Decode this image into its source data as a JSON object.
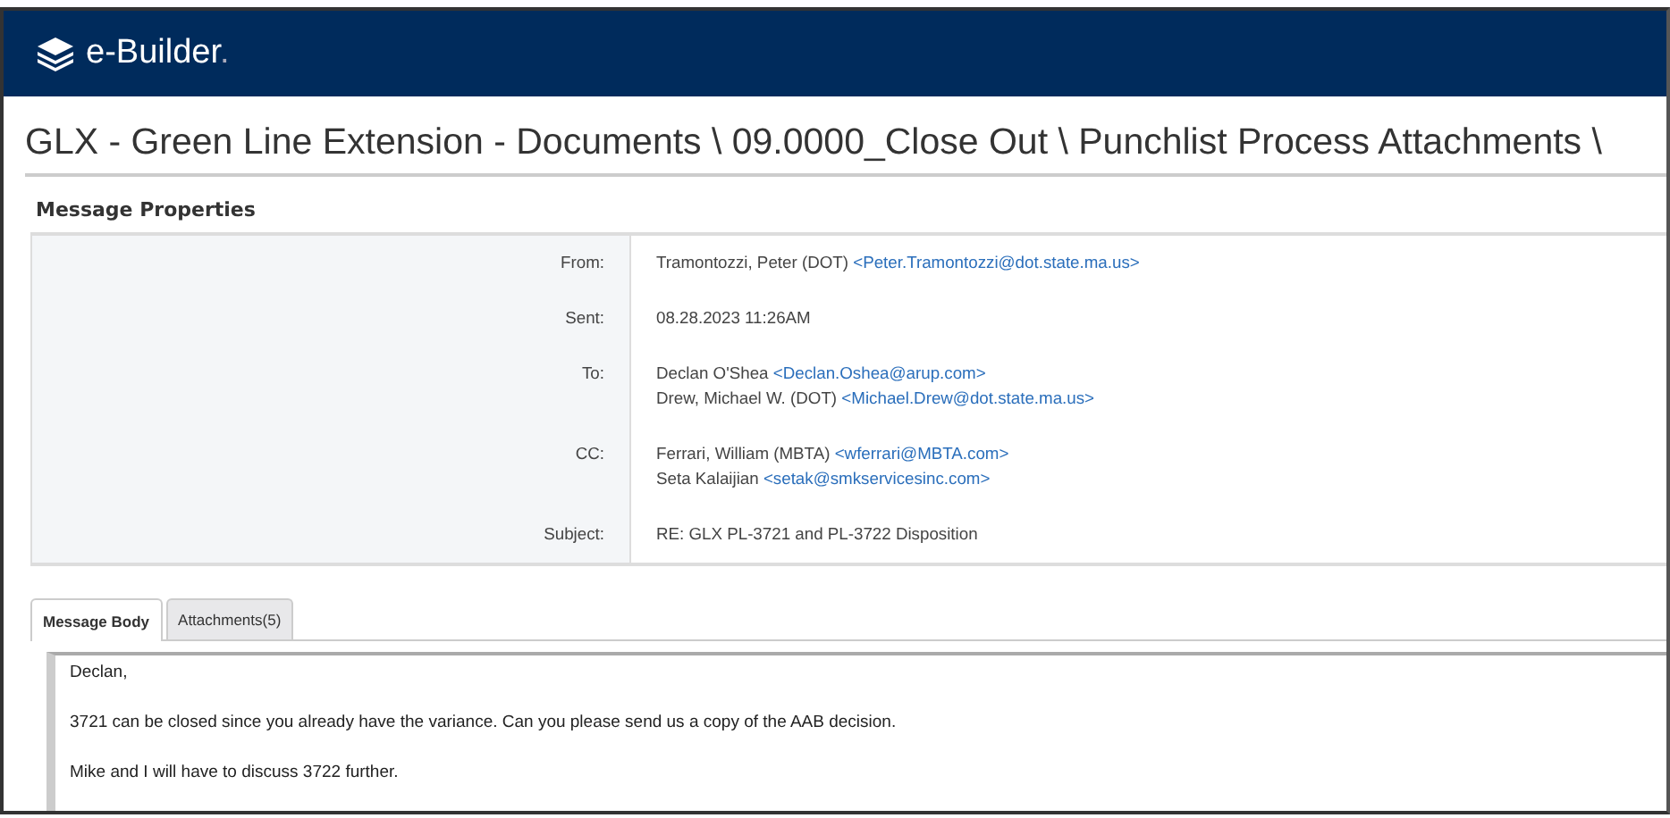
{
  "header": {
    "brand": "e-Builder",
    "brand_mark": "."
  },
  "title": "GLX - Green Line Extension - Documents \\ 09.0000_Close Out \\ Punchlist Process Attachments \\",
  "section_title": "Message Properties",
  "properties": [
    {
      "label": "From:",
      "kind": "people",
      "people": [
        {
          "name": "Tramontozzi, Peter (DOT)",
          "email": "<Peter.Tramontozzi@dot.state.ma.us>"
        }
      ]
    },
    {
      "label": "Sent:",
      "kind": "text",
      "value": "08.28.2023 11:26AM"
    },
    {
      "label": "To:",
      "kind": "people",
      "people": [
        {
          "name": "Declan O'Shea",
          "email": "<Declan.Oshea@arup.com>"
        },
        {
          "name": "Drew, Michael W. (DOT)",
          "email": "<Michael.Drew@dot.state.ma.us>"
        }
      ]
    },
    {
      "label": "CC:",
      "kind": "people",
      "people": [
        {
          "name": "Ferrari, William (MBTA)",
          "email": "<wferrari@MBTA.com>"
        },
        {
          "name": "Seta Kalaijian",
          "email": "<setak@smkservicesinc.com>"
        }
      ]
    },
    {
      "label": "Subject:",
      "kind": "text",
      "value": "RE: GLX PL-3721 and PL-3722 Disposition"
    }
  ],
  "tabs": [
    {
      "label": "Message Body",
      "selected": true
    },
    {
      "label": "Attachments(5)",
      "selected": false
    }
  ],
  "body": [
    "Declan,",
    "3721 can be closed since you already have the variance.  Can you please send us a copy of the AAB decision.",
    "Mike and I will have to discuss 3722 further."
  ]
}
